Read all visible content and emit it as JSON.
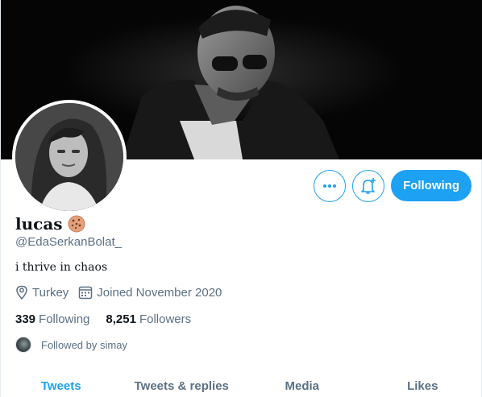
{
  "profile": {
    "display_name": "lucas",
    "handle": "@EdaSerkanBolat_",
    "bio": "i thrive in chaos",
    "location": "Turkey",
    "joined": "Joined November 2020",
    "name_emoji": "cookie-icon"
  },
  "stats": {
    "following_count": "339",
    "following_label": "Following",
    "followers_count": "8,251",
    "followers_label": "Followers"
  },
  "followed_by": "Followed by simay",
  "actions": {
    "follow_label": "Following",
    "more_icon": "more-icon",
    "notify_icon": "bell-plus-icon"
  },
  "tabs": [
    {
      "label": "Tweets",
      "active": true
    },
    {
      "label": "Tweets & replies",
      "active": false
    },
    {
      "label": "Media",
      "active": false
    },
    {
      "label": "Likes",
      "active": false
    }
  ],
  "colors": {
    "accent": "#1da1f2",
    "secondary_text": "#5b7083",
    "primary_text": "#0f1419"
  }
}
